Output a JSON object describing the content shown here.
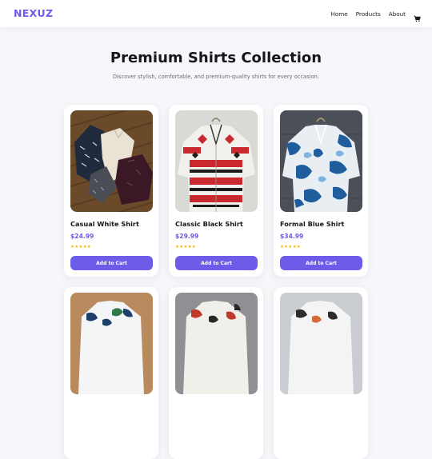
{
  "nav": {
    "brand": "NEXUZ",
    "links": [
      "Home",
      "Products",
      "About"
    ],
    "cart_icon": "cart-icon"
  },
  "hero": {
    "title": "Premium Shirts Collection",
    "subtitle": "Discover stylish, comfortable, and premium-quality shirts for every occasion."
  },
  "products": [
    {
      "name": "Casual White Shirt",
      "price": "$24.99",
      "rating": 5,
      "stars": "★★★★★",
      "button": "Add to Cart"
    },
    {
      "name": "Classic Black Shirt",
      "price": "$29.99",
      "rating": 5,
      "stars": "★★★★★",
      "button": "Add to Cart"
    },
    {
      "name": "Formal Blue Shirt",
      "price": "$34.99",
      "rating": 5,
      "stars": "★★★★★",
      "button": "Add to Cart"
    }
  ],
  "colors": {
    "accent": "#6c5ce7",
    "star": "#f5b301",
    "background": "#f6f7fb"
  }
}
